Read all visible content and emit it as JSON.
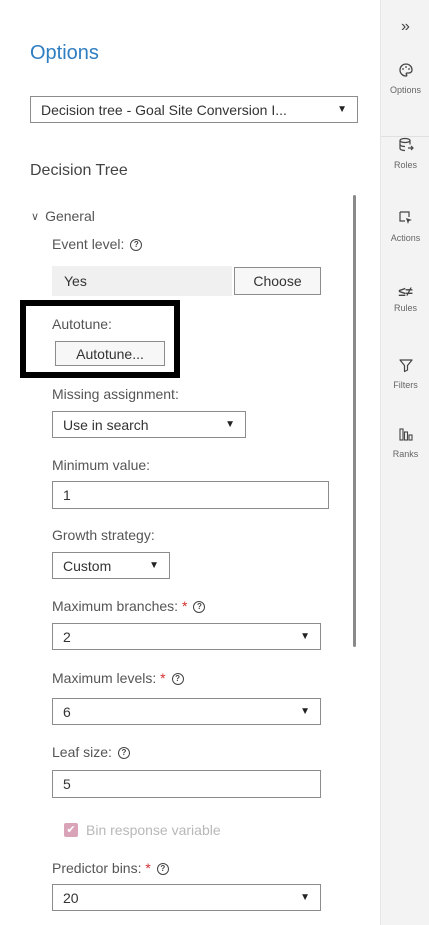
{
  "panel": {
    "title": "Options",
    "model_select": "Decision tree - Goal Site Conversion I...",
    "section_title": "Decision Tree"
  },
  "general": {
    "label": "General",
    "event_level_label": "Event level:",
    "event_level_value": "Yes",
    "choose_label": "Choose",
    "autotune_label": "Autotune:",
    "autotune_button": "Autotune...",
    "missing_assignment_label": "Missing assignment:",
    "missing_assignment_value": "Use in search",
    "minimum_value_label": "Minimum value:",
    "minimum_value": "1",
    "growth_strategy_label": "Growth strategy:",
    "growth_strategy_value": "Custom",
    "max_branches_label": "Maximum branches:",
    "max_branches_value": "2",
    "max_levels_label": "Maximum levels:",
    "max_levels_value": "6",
    "leaf_size_label": "Leaf size:",
    "leaf_size_value": "5",
    "bin_response_label": "Bin response variable",
    "predictor_bins_label": "Predictor bins:",
    "predictor_bins_value": "20",
    "required_marker": "*",
    "help_glyph": "?"
  },
  "rail": {
    "collapse": "»",
    "items": [
      {
        "label": "Options",
        "icon": "palette-icon"
      },
      {
        "label": "Roles",
        "icon": "database-icon"
      },
      {
        "label": "Actions",
        "icon": "cursor-icon"
      },
      {
        "label": "Rules",
        "icon": "rules-icon"
      },
      {
        "label": "Filters",
        "icon": "filter-icon"
      },
      {
        "label": "Ranks",
        "icon": "ranks-icon"
      }
    ]
  },
  "colors": {
    "title_blue": "#2f7ec1",
    "required_red": "#d32f2f",
    "highlight_box": "#000000",
    "checkbox_pink": "#d9a3b8"
  }
}
